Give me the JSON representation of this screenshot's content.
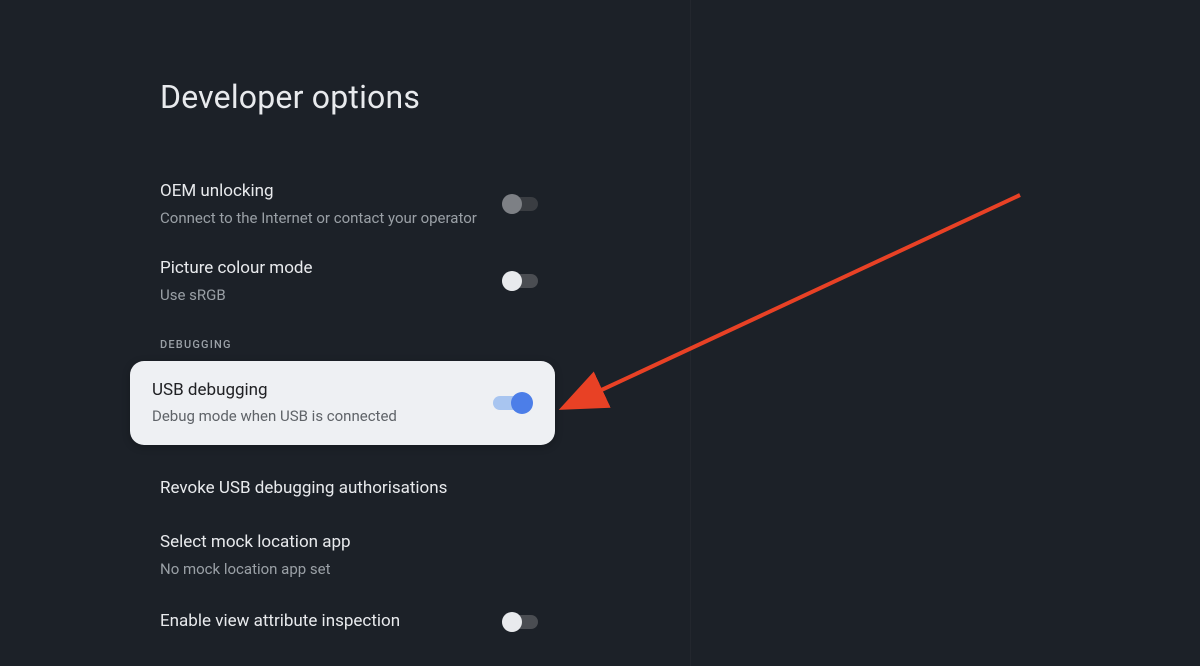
{
  "page": {
    "title": "Developer options"
  },
  "settings": {
    "oem": {
      "title": "OEM unlocking",
      "subtitle": "Connect to the Internet or contact your operator",
      "state": "off-disabled"
    },
    "picture": {
      "title": "Picture colour mode",
      "subtitle": "Use sRGB",
      "state": "off"
    },
    "section_debugging": "DEBUGGING",
    "usb_debugging": {
      "title": "USB debugging",
      "subtitle": "Debug mode when USB is connected",
      "state": "on"
    },
    "revoke": {
      "title": "Revoke USB debugging authorisations"
    },
    "mock_location": {
      "title": "Select mock location app",
      "subtitle": "No mock location app set"
    },
    "view_attribute": {
      "title": "Enable view attribute inspection",
      "state": "off"
    }
  },
  "annotation": {
    "type": "arrow",
    "color": "#e84125"
  }
}
